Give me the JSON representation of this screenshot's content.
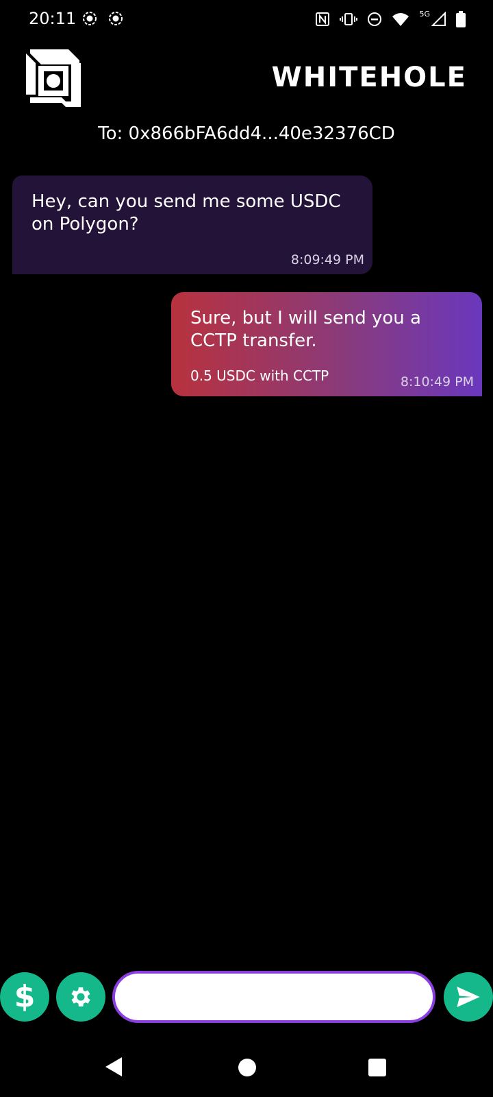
{
  "status_bar": {
    "time": "20:11",
    "network": "5G",
    "icons": [
      "record-icon",
      "record-icon",
      "nfc-icon",
      "vibrate-icon",
      "dnd-icon",
      "wifi-icon",
      "signal-icon",
      "battery-icon"
    ]
  },
  "header": {
    "brand": "WHITEHOLE",
    "recipient": "To: 0x866bFA6dd4...40e32376CD"
  },
  "messages": [
    {
      "direction": "incoming",
      "text": "Hey, can you send me some USDC on Polygon?",
      "time": "8:09:49 PM"
    },
    {
      "direction": "outgoing",
      "text": "Sure, but I will send you a CCTP transfer.",
      "subtext": "0.5 USDC with CCTP",
      "time": "8:10:49 PM"
    }
  ],
  "input_bar": {
    "dollar_label": "$",
    "placeholder": "",
    "value": ""
  },
  "colors": {
    "accent": "#14b88a",
    "input_border": "#8a3ee0",
    "incoming_bubble": "#231338",
    "outgoing_gradient": [
      "#b8323e",
      "#6a38bd"
    ]
  }
}
